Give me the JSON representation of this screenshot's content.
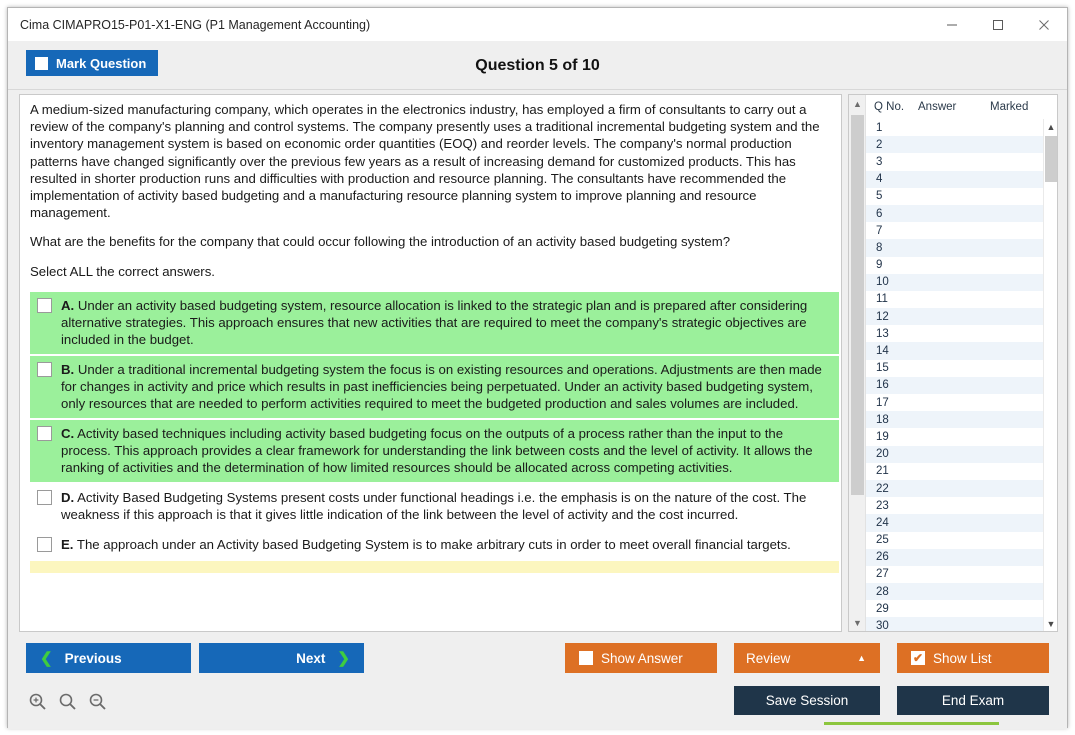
{
  "window": {
    "title": "Cima CIMAPRO15-P01-X1-ENG (P1 Management Accounting)",
    "minimize": "minimize-icon",
    "maximize": "maximize-icon",
    "close": "close-icon"
  },
  "header": {
    "mark_question_label": "Mark Question",
    "mark_question_checked": false,
    "question_title": "Question 5 of 10"
  },
  "question": {
    "paragraphs": [
      "A medium-sized manufacturing company, which operates in the electronics industry, has employed a firm of consultants to carry out a review of the company's planning and control systems. The company presently uses a traditional incremental budgeting system and the inventory management system is based on economic order quantities (EOQ) and reorder levels. The company's normal production patterns have changed significantly over the previous few years as a result of increasing demand for customized products. This has resulted in shorter production runs and difficulties with production and resource planning. The consultants have recommended the implementation of activity based budgeting and a manufacturing resource planning system to improve planning and resource management.",
      "What are the benefits for the company that could occur following the introduction of an activity based budgeting system?",
      "Select ALL the correct answers."
    ],
    "options": [
      {
        "letter": "A.",
        "text": " Under an activity based budgeting system, resource allocation is linked to the strategic plan and is prepared after considering alternative strategies. This approach ensures that new activities that are required to meet the company's strategic objectives are included in the budget.",
        "highlight": "green",
        "checked": false
      },
      {
        "letter": "B.",
        "text": " Under a traditional incremental budgeting system the focus is on existing resources and operations. Adjustments are then made for changes in activity and price which results in past inefficiencies being perpetuated. Under an activity based budgeting system, only resources that are needed to perform activities required to meet the budgeted production and sales volumes are included.",
        "highlight": "green",
        "checked": false
      },
      {
        "letter": "C.",
        "text": " Activity based techniques including activity based budgeting focus on the outputs of a process rather than the input to the process. This approach provides a clear framework for understanding the link between costs and the level of activity. It allows the ranking of activities and the determination of how limited resources should be allocated across competing activities.",
        "highlight": "green",
        "checked": false
      },
      {
        "letter": "D.",
        "text": " Activity Based Budgeting Systems present costs under functional headings i.e. the emphasis is on the nature of the cost. The weakness if this approach is that it gives little indication of the link between the level of activity and the cost incurred.",
        "highlight": "plain",
        "checked": false
      },
      {
        "letter": "E.",
        "text": " The approach under an Activity based Budgeting System is to make arbitrary cuts in order to meet overall financial targets.",
        "highlight": "plain",
        "checked": false
      },
      {
        "letter": "",
        "text": "",
        "highlight": "yellow",
        "checked": false
      }
    ]
  },
  "question_list": {
    "columns": [
      "Q No.",
      "Answer",
      "Marked"
    ],
    "rows": [
      {
        "no": "1",
        "answer": "",
        "marked": ""
      },
      {
        "no": "2",
        "answer": "",
        "marked": ""
      },
      {
        "no": "3",
        "answer": "",
        "marked": ""
      },
      {
        "no": "4",
        "answer": "",
        "marked": ""
      },
      {
        "no": "5",
        "answer": "",
        "marked": ""
      },
      {
        "no": "6",
        "answer": "",
        "marked": ""
      },
      {
        "no": "7",
        "answer": "",
        "marked": ""
      },
      {
        "no": "8",
        "answer": "",
        "marked": ""
      },
      {
        "no": "9",
        "answer": "",
        "marked": ""
      },
      {
        "no": "10",
        "answer": "",
        "marked": ""
      },
      {
        "no": "11",
        "answer": "",
        "marked": ""
      },
      {
        "no": "12",
        "answer": "",
        "marked": ""
      },
      {
        "no": "13",
        "answer": "",
        "marked": ""
      },
      {
        "no": "14",
        "answer": "",
        "marked": ""
      },
      {
        "no": "15",
        "answer": "",
        "marked": ""
      },
      {
        "no": "16",
        "answer": "",
        "marked": ""
      },
      {
        "no": "17",
        "answer": "",
        "marked": ""
      },
      {
        "no": "18",
        "answer": "",
        "marked": ""
      },
      {
        "no": "19",
        "answer": "",
        "marked": ""
      },
      {
        "no": "20",
        "answer": "",
        "marked": ""
      },
      {
        "no": "21",
        "answer": "",
        "marked": ""
      },
      {
        "no": "22",
        "answer": "",
        "marked": ""
      },
      {
        "no": "23",
        "answer": "",
        "marked": ""
      },
      {
        "no": "24",
        "answer": "",
        "marked": ""
      },
      {
        "no": "25",
        "answer": "",
        "marked": ""
      },
      {
        "no": "26",
        "answer": "",
        "marked": ""
      },
      {
        "no": "27",
        "answer": "",
        "marked": ""
      },
      {
        "no": "28",
        "answer": "",
        "marked": ""
      },
      {
        "no": "29",
        "answer": "",
        "marked": ""
      },
      {
        "no": "30",
        "answer": "",
        "marked": ""
      }
    ]
  },
  "toolbar": {
    "previous_label": "Previous",
    "next_label": "Next",
    "show_answer_label": "Show Answer",
    "show_answer_checked": false,
    "review_label": "Review",
    "show_list_label": "Show List",
    "show_list_checked": true,
    "show_list_check_glyph": "✔",
    "save_session_label": "Save Session",
    "end_exam_label": "End Exam",
    "prev_chevron": "❮",
    "next_chevron": "❯",
    "review_chevron": "▲",
    "zoom_in_icon": "zoom-in-icon",
    "zoom_reset_icon": "zoom-reset-icon",
    "zoom_out_icon": "zoom-out-icon"
  },
  "colors": {
    "accent_blue": "#1668b8",
    "accent_orange": "#dd7024",
    "dark_navy": "#1f3549",
    "correct_green": "#9bf09b",
    "highlight_yellow": "#fcf6bf",
    "chevron_green": "#3fcc3f"
  }
}
